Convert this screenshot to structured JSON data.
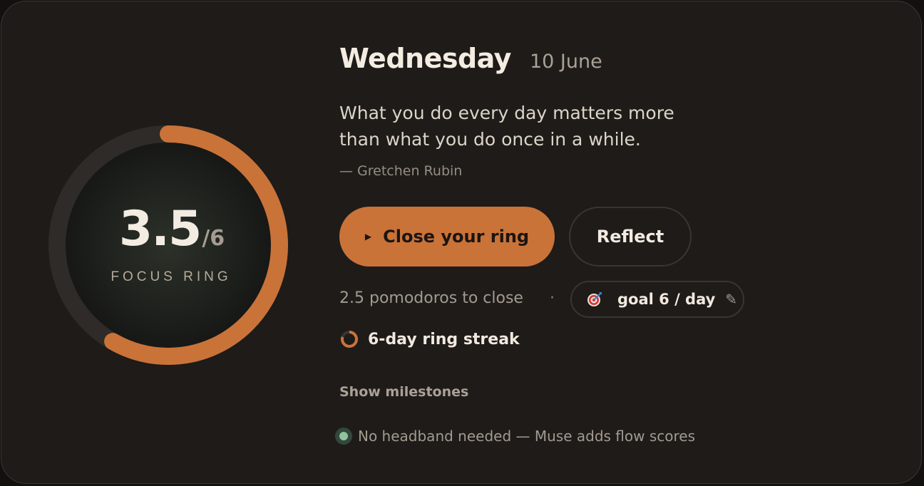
{
  "ring": {
    "done": "3.5",
    "goal": "/6",
    "label": "FOCUS RING",
    "progress": 0.583
  },
  "header": {
    "day": "Wednesday",
    "date": "10 June"
  },
  "quote": {
    "line1": "What you do every day matters more",
    "line2": "than what you do once in a while.",
    "author": "— Gretchen Rubin"
  },
  "actions": {
    "primary_label": "Close your ring",
    "secondary_label": "Reflect"
  },
  "status": {
    "remaining": "2.5 pomodoros to close",
    "separator": "·",
    "goal": "goal 6 / day",
    "streak": "6-day ring streak",
    "milestones": "Show milestones",
    "muse": "No headband needed — Muse adds flow scores"
  },
  "colors": {
    "accent": "#c97339",
    "background": "#1e1b19",
    "muse_dot": "#8fc49e"
  },
  "icons": {
    "play": "play-icon",
    "goal": "target-icon",
    "edit": "pencil-icon",
    "streak": "ring-streak-icon",
    "status": "status-dot-icon"
  }
}
